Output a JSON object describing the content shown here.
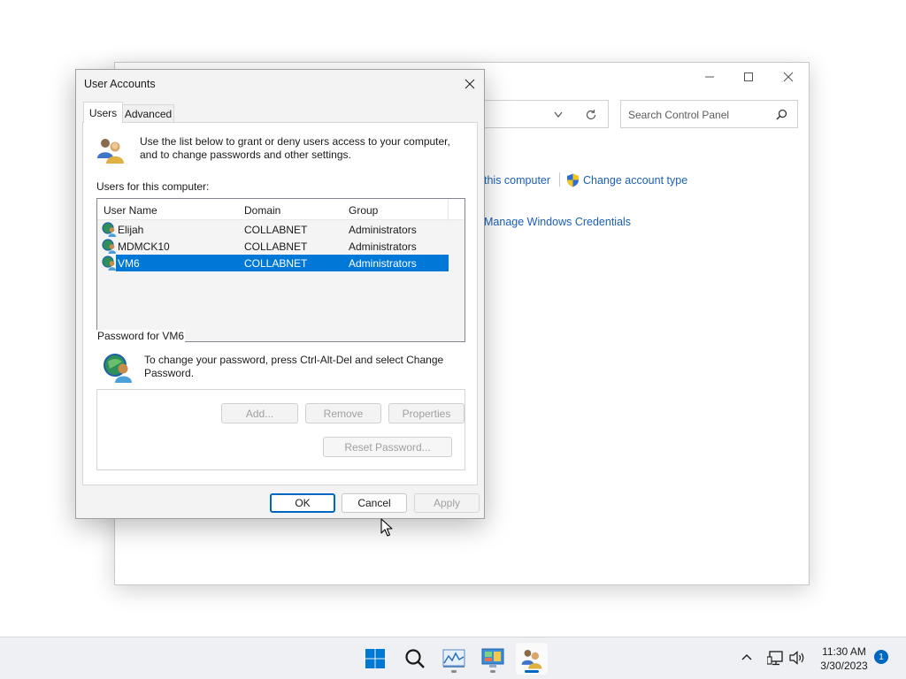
{
  "control_panel": {
    "search_placeholder": "Search Control Panel",
    "link_this_computer": "this computer",
    "link_change_account_type": "Change account type",
    "link_manage_credentials": "Manage Windows Credentials"
  },
  "dialog": {
    "title": "User Accounts",
    "tabs": [
      {
        "label": "Users"
      },
      {
        "label": "Advanced"
      }
    ],
    "intro": "Use the list below to grant or deny users access to your computer, and to change passwords and other settings.",
    "users_label": "Users for this computer:",
    "columns": [
      "User Name",
      "Domain",
      "Group"
    ],
    "users": [
      {
        "name": "Elijah",
        "domain": "COLLABNET",
        "group": "Administrators"
      },
      {
        "name": "MDMCK10",
        "domain": "COLLABNET",
        "group": "Administrators"
      },
      {
        "name": "VM6",
        "domain": "COLLABNET",
        "group": "Administrators"
      }
    ],
    "selected_user": "VM6",
    "buttons": {
      "add": "Add...",
      "remove": "Remove",
      "properties": "Properties",
      "reset_password": "Reset Password...",
      "ok": "OK",
      "cancel": "Cancel",
      "apply": "Apply"
    },
    "password_group_label": "Password for VM6",
    "password_text": "To change your password, press Ctrl-Alt-Del and select Change Password."
  },
  "taskbar": {
    "time": "11:30 AM",
    "date": "3/30/2023",
    "notification_count": "1"
  },
  "colors": {
    "selection": "#0078d7",
    "accent": "#0067c0",
    "link": "#1a5fb4"
  }
}
